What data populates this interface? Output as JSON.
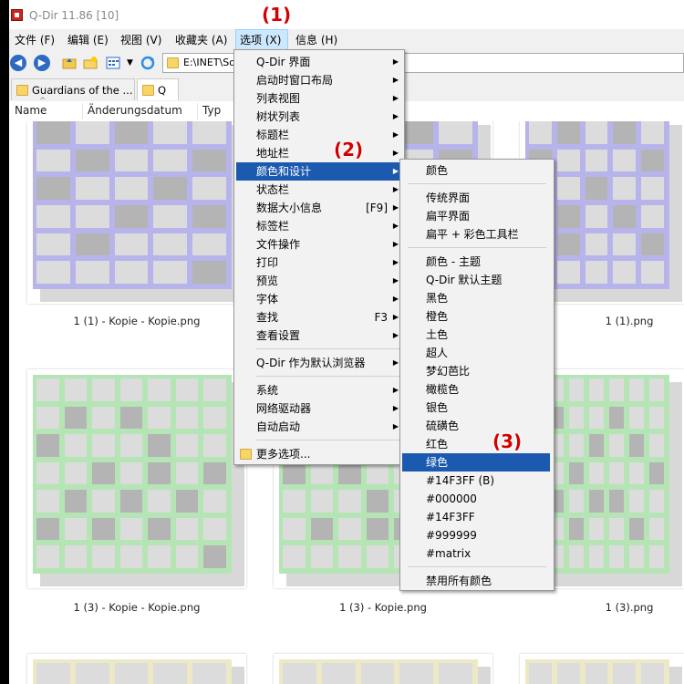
{
  "window": {
    "title": "Q-Dir 11.86 [10]"
  },
  "menubar": [
    {
      "label": "文件 (F)"
    },
    {
      "label": "编辑 (E)"
    },
    {
      "label": "视图 (V)"
    },
    {
      "label": "收藏夹 (A)"
    },
    {
      "label": "选项 (X)"
    },
    {
      "label": "信息 (H)"
    }
  ],
  "toolbar": {
    "back_icon": "back-arrow-icon",
    "forward_icon": "forward-arrow-icon",
    "address": "E:\\INET\\So"
  },
  "tabs": [
    {
      "label": "Guardians of the ..."
    },
    {
      "label": "Q"
    }
  ],
  "columns": [
    "Name",
    "Änderungsdatum",
    "Typ"
  ],
  "files": [
    {
      "caption": "1 (1) - Kopie - Kopie.png"
    },
    {
      "caption": "1 (1).png"
    },
    {
      "caption": "1 (3) - Kopie - Kopie.png"
    },
    {
      "caption": "1 (3) - Kopie.png"
    },
    {
      "caption": "1 (3).png"
    }
  ],
  "thumb_colors": {
    "purple_frame": "#b7b4ec",
    "purple_cell": "#dcdcdc",
    "purple_dark": "#b4b4b4",
    "green_frame": "#b5e5b5",
    "yellow_frame": "#ede8c6"
  },
  "options_menu": {
    "items": [
      {
        "label": "Q-Dir 界面",
        "submenu": true
      },
      {
        "label": "启动时窗口布局",
        "submenu": true
      },
      {
        "label": "列表视图",
        "submenu": true
      },
      {
        "label": "树状列表",
        "submenu": true
      },
      {
        "label": "标题栏",
        "submenu": true
      },
      {
        "label": "地址栏",
        "submenu": true
      },
      {
        "label": "颜色和设计",
        "submenu": true
      },
      {
        "label": "状态栏",
        "submenu": true
      },
      {
        "label": "数据大小信息",
        "shortcut": "[F9]",
        "submenu": true
      },
      {
        "label": "标签栏",
        "submenu": true
      },
      {
        "label": "文件操作",
        "submenu": true
      },
      {
        "label": "打印",
        "submenu": true
      },
      {
        "label": "预览",
        "submenu": true
      },
      {
        "label": "字体",
        "submenu": true
      },
      {
        "label": "查找",
        "shortcut": "F3",
        "submenu": true
      },
      {
        "label": "查看设置",
        "submenu": true
      },
      {
        "label": "Q-Dir 作为默认浏览器",
        "submenu": true
      },
      {
        "label": "系统",
        "submenu": true
      },
      {
        "label": "网络驱动器",
        "submenu": true
      },
      {
        "label": "自动启动",
        "submenu": true
      },
      {
        "label": "更多选项..."
      }
    ]
  },
  "color_submenu": {
    "items": [
      {
        "label": "颜色"
      },
      {
        "label": "传统界面"
      },
      {
        "label": "扁平界面"
      },
      {
        "label": "扁平 + 彩色工具栏"
      },
      {
        "label": "颜色 - 主题"
      },
      {
        "label": "Q-Dir 默认主题"
      },
      {
        "label": "黑色"
      },
      {
        "label": "橙色"
      },
      {
        "label": "土色"
      },
      {
        "label": "超人"
      },
      {
        "label": "梦幻芭比"
      },
      {
        "label": "橄榄色"
      },
      {
        "label": "银色"
      },
      {
        "label": "硫磺色"
      },
      {
        "label": "红色"
      },
      {
        "label": "绿色"
      },
      {
        "label": "#14F3FF (B)"
      },
      {
        "label": "#000000"
      },
      {
        "label": "#14F3FF"
      },
      {
        "label": "#999999"
      },
      {
        "label": "#matrix"
      },
      {
        "label": "禁用所有颜色"
      }
    ]
  },
  "callouts": [
    "(1)",
    "(2)",
    "(3)"
  ]
}
